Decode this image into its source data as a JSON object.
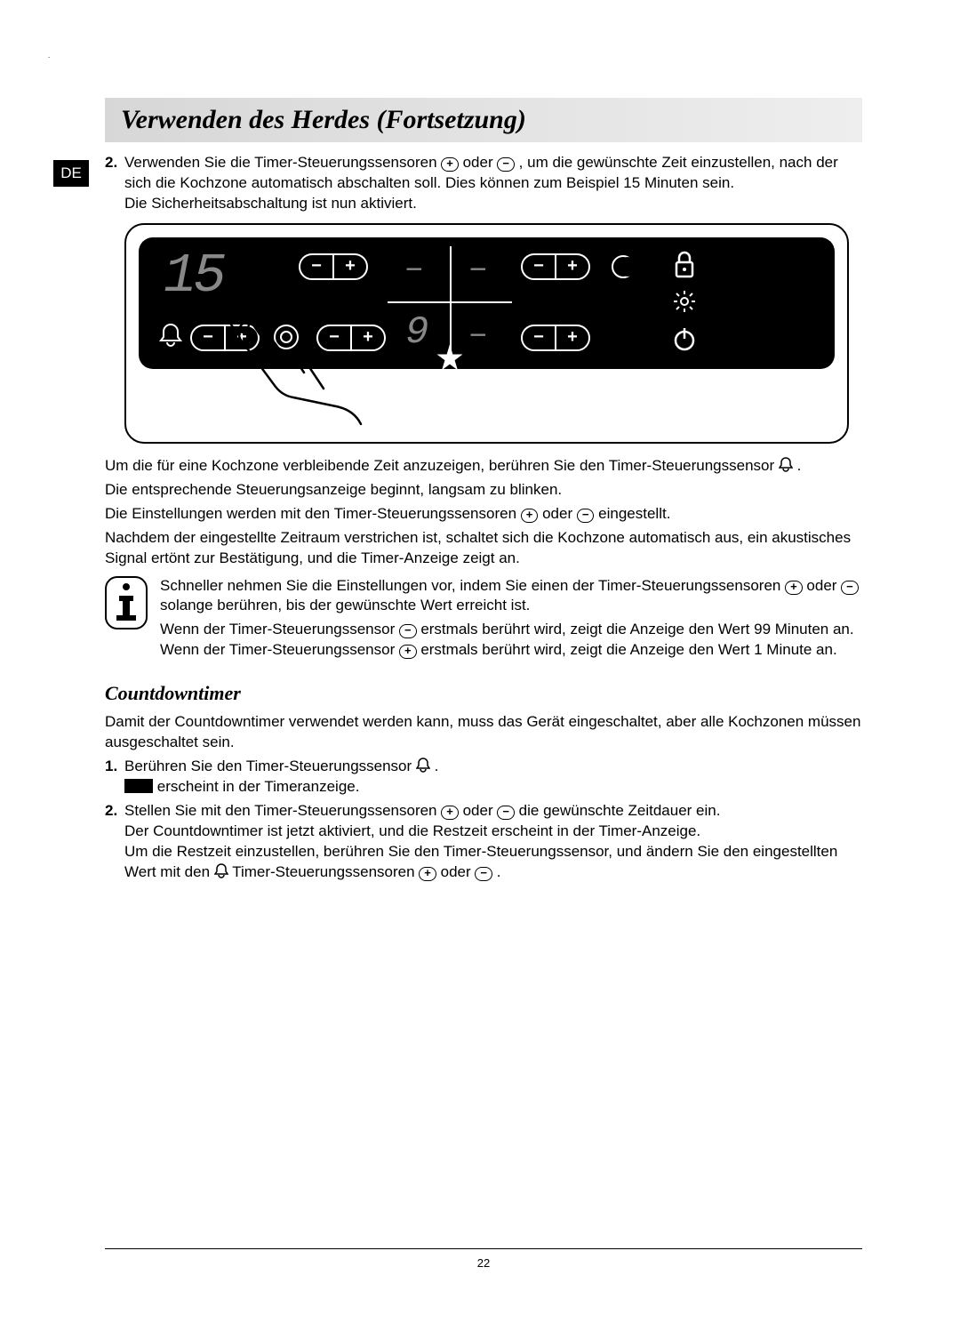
{
  "lang_badge": "DE",
  "title": "Verwenden des Herdes (Fortsetzung)",
  "step2": {
    "num": "2.",
    "line1a": "Verwenden Sie die Timer-Steuerungssensoren ",
    "line1b": " oder ",
    "line1c": ", um die gewünschte Zeit einzustellen, nach der sich die Kochzone automatisch abschalten soll. Dies können zum Beispiel 15 Minuten sein.",
    "line2": "Die Sicherheitsabschaltung ist nun aktiviert."
  },
  "panel": {
    "timer_value": "15"
  },
  "after_panel": {
    "p1a": "Um die für eine Kochzone verbleibende Zeit anzuzeigen, berühren Sie den Timer-Steuerungssensor ",
    "p1b": ".",
    "p2": "Die entsprechende Steuerungsanzeige beginnt, langsam zu blinken.",
    "p3a": "Die Einstellungen werden mit den Timer-Steuerungssensoren ",
    "p3b": " oder ",
    "p3c": " eingestellt.",
    "p4": "Nachdem der eingestellte Zeitraum verstrichen ist, schaltet sich die Kochzone automatisch aus, ein akustisches Signal ertönt zur Bestätigung, und die Timer-Anzeige zeigt an."
  },
  "info": {
    "p1a": "Schneller nehmen Sie die Einstellungen vor, indem Sie einen der Timer-Steuerungssensoren ",
    "p1b": " oder ",
    "p1c": " solange berühren, bis der gewünschte Wert erreicht ist.",
    "p2a": "Wenn der Timer-Steuerungssensor ",
    "p2b": " erstmals berührt wird, zeigt die Anzeige den Wert 99 Minuten an. Wenn der Timer-Steuerungssensor ",
    "p2c": " erstmals berührt wird, zeigt die Anzeige den Wert 1 Minute an."
  },
  "countdown": {
    "heading": "Countdowntimer",
    "intro": "Damit der Countdowntimer verwendet werden kann, muss das Gerät eingeschaltet, aber alle Kochzonen müssen ausgeschaltet sein.",
    "s1": {
      "num": "1.",
      "a": "Berühren Sie den Timer-Steuerungssensor ",
      "b": ".",
      "c": " erscheint in der Timeranzeige."
    },
    "s2": {
      "num": "2.",
      "a": "Stellen Sie mit den Timer-Steuerungssensoren ",
      "b": " oder ",
      "c": " die gewünschte Zeitdauer ein.",
      "d": "Der Countdowntimer ist jetzt aktiviert, und die Restzeit erscheint in der Timer-Anzeige.",
      "e": "Um die Restzeit einzustellen, berühren Sie den Timer-Steuerungssensor, und ändern Sie den eingestellten Wert mit den ",
      "f": " Timer-Steuerungssensoren ",
      "g": " oder ",
      "h": " ."
    }
  },
  "page_number": "22",
  "icons": {
    "plus": "+",
    "minus": "−"
  }
}
